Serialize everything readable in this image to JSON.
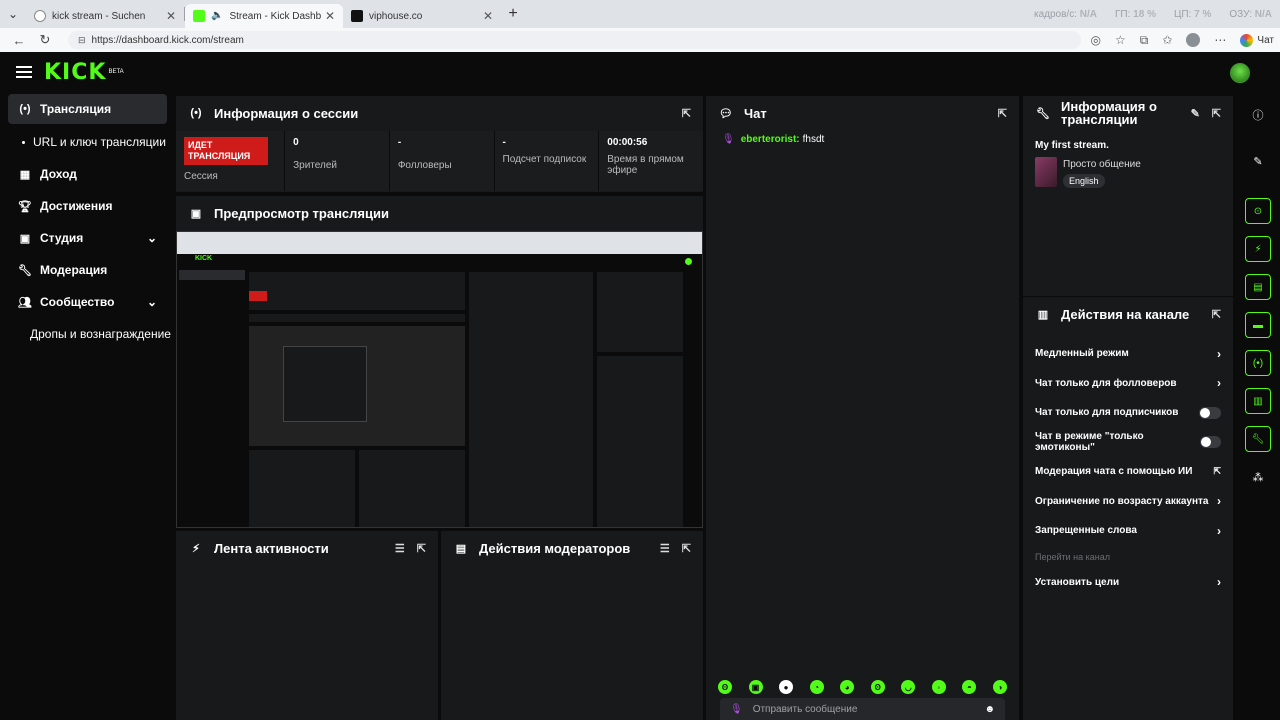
{
  "browser": {
    "tabs": [
      {
        "title": "kick stream - Suchen"
      },
      {
        "title": "Stream - Kick Dashboard"
      },
      {
        "title": "viphouse.co"
      }
    ],
    "sysinfo": {
      "k1": "кадров/с:",
      "v1": "N/A",
      "k2": "ГП:",
      "v2": "18 %",
      "k3": "ЦП:",
      "v3": "7 %",
      "k4": "ОЗУ:",
      "v4": "N/A"
    },
    "url": "https://dashboard.kick.com/stream",
    "chat_label": "Чат"
  },
  "header": {
    "logo": "KICK",
    "beta": "BETA"
  },
  "sidebar": {
    "items": [
      {
        "label": "Трансляция"
      },
      {
        "label": "URL и ключ трансляции"
      },
      {
        "label": "Доход"
      },
      {
        "label": "Достижения"
      },
      {
        "label": "Студия"
      },
      {
        "label": "Модерация"
      },
      {
        "label": "Сообщество"
      },
      {
        "label": "Дропы и вознаграждение"
      }
    ]
  },
  "session": {
    "title": "Информация о сессии",
    "live_badge": "ИДЕТ ТРАНСЛЯЦИЯ",
    "session_label": "Сессия",
    "stats": [
      {
        "value": "0",
        "label": "Зрителей"
      },
      {
        "value": "-",
        "label": "Фолловеры"
      },
      {
        "value": "-",
        "label": "Подсчет подписок"
      },
      {
        "value": "00:00:56",
        "label": "Время в прямом эфире"
      }
    ]
  },
  "preview": {
    "title": "Предпросмотр трансляции"
  },
  "activity": {
    "title": "Лента активности"
  },
  "modactions": {
    "title": "Действия модераторов"
  },
  "chat": {
    "title": "Чат",
    "messages": [
      {
        "user": "eberterorist:",
        "text": "fhsdt"
      }
    ],
    "input_placeholder": "Отправить сообщение"
  },
  "stream_info": {
    "title": "Информация о трансляции",
    "stream_title": "My first stream.",
    "category": "Просто общение",
    "language": "English"
  },
  "channel_actions": {
    "title": "Действия на канале",
    "rows": [
      {
        "label": "Медленный режим"
      },
      {
        "label": "Чат только для фолловеров"
      },
      {
        "label": "Чат только для подписчиков"
      },
      {
        "label": "Чат в режиме \"только эмотиконы\""
      },
      {
        "label": "Модерация чата с помощью ИИ"
      },
      {
        "label": "Ограничение по возрасту аккаунта"
      },
      {
        "label": "Запрещенные слова"
      },
      {
        "label": "Перейти на канал"
      },
      {
        "label": "Установить цели"
      }
    ]
  },
  "colors": {
    "accent": "#53fc18",
    "live": "#d01b1b",
    "panel": "#18191b",
    "bg": "#0b0b0c"
  }
}
